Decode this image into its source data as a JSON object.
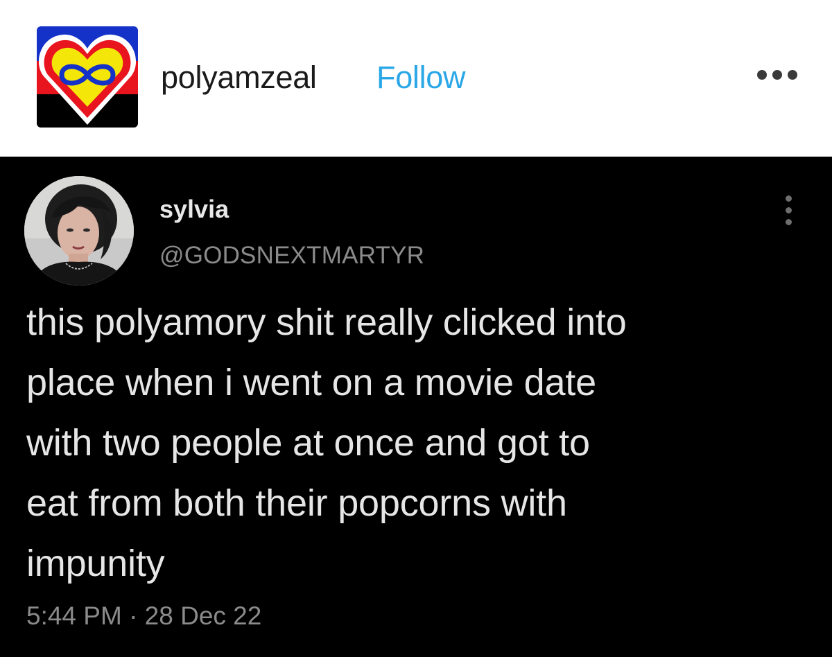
{
  "header": {
    "avatar_icon": "polyamory-infinity-heart-icon",
    "username": "polyamzeal",
    "follow_label": "Follow",
    "more_icon": "more-horizontal-icon",
    "colors": {
      "follow": "#2aa7e6",
      "flag_blue": "#1432c8",
      "flag_red": "#e8141e",
      "flag_black": "#000000",
      "heart_yellow": "#f5e60a"
    }
  },
  "tweet": {
    "author_name": "sylvia",
    "author_handle": "@GODSNEXTMARTYR",
    "more_icon": "more-vertical-icon",
    "text_lines": [
      "this polyamory shit really clicked into",
      "place when i went on a movie date",
      "with two people at once and got to",
      "eat from both their popcorns with",
      "impunity"
    ],
    "timestamp": "5:44 PM · 28 Dec 22",
    "colors": {
      "background": "#000000",
      "text": "#e6e6e6",
      "secondary": "#8b8b8b"
    }
  }
}
